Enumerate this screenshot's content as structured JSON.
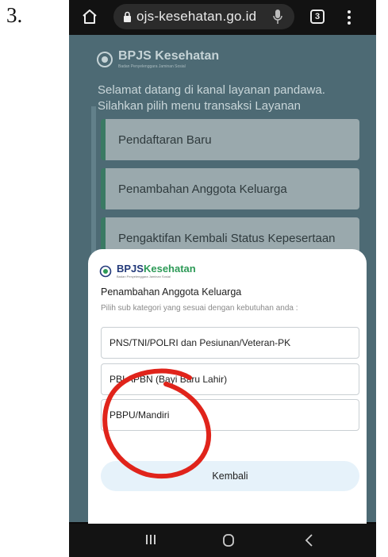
{
  "step_number": "3.",
  "browser": {
    "url": "ojs-kesehatan.go.id",
    "tab_count": "3"
  },
  "page": {
    "brand": "BPJS Kesehatan",
    "brand_sub": "Badan Penyelenggara Jaminan Sosial",
    "welcome": "Selamat datang di kanal layanan pandawa. Silahkan pilih menu transaksi Layanan",
    "menu_items": [
      "Pendaftaran Baru",
      "Penambahan Anggota Keluarga",
      "Pengaktifan Kembali Status Kepesertaan"
    ]
  },
  "sheet": {
    "brand_bp": "BPJS",
    "brand_ks": "Kesehatan",
    "brand_sub": "Badan Penyelenggara Jaminan Sosial",
    "title": "Penambahan Anggota Keluarga",
    "subtitle": "Pilih sub kategori yang sesuai dengan kebutuhan anda :",
    "options": [
      "PNS/TNI/POLRI dan Pesiunan/Veteran-PK",
      "PBI APBN (Bayi Baru Lahir)",
      "PBPU/Mandiri"
    ],
    "back_label": "Kembali"
  },
  "colors": {
    "annotation": "#e0241b",
    "brand_green": "#2d9a57",
    "brand_blue": "#233a7a",
    "dim_page": "#4d6a74"
  }
}
